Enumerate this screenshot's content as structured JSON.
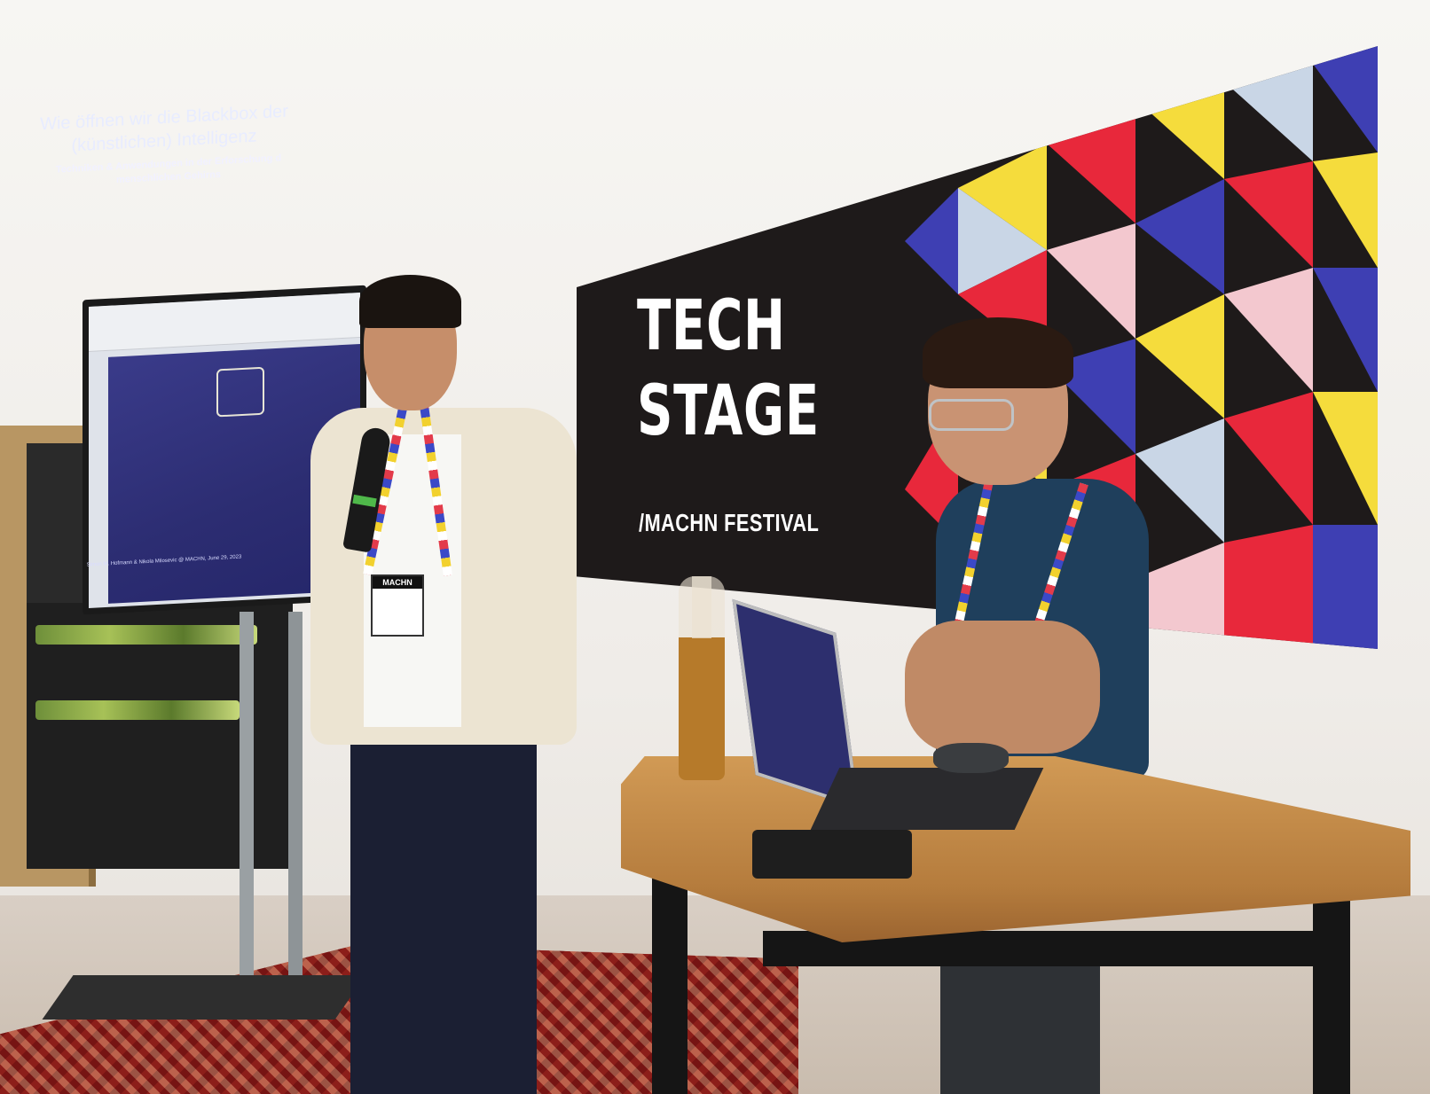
{
  "banner": {
    "title": "TECH\nSTAGE",
    "subtitle": "/MACHN FESTIVAL"
  },
  "slide": {
    "title": "Wie öffnen wir die Blackbox der\n(künstlichen) Intelligenz",
    "subtitle": "Techniken & Anwendungen in der Erforschung d\nmenschlichen Gehirns",
    "authors": "Simon M. Hofmann & Nikola Milosevic @ MACHN, June 29, 2023"
  },
  "badge": {
    "header": "MACHN"
  },
  "colors": {
    "banner_black": "#1e1a1a",
    "red": "#e8283b",
    "blue": "#3e3fb3",
    "yellow": "#f5dc3c",
    "pink": "#f3c8cf",
    "lightblue": "#c9d6e6",
    "slide_bg": "#2c2d72",
    "wood": "#c8893f"
  }
}
